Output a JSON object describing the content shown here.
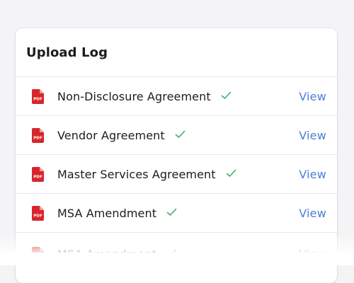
{
  "card": {
    "title": "Upload Log"
  },
  "uploads": [
    {
      "name": "Non-Disclosure Agreement",
      "status": "uploaded",
      "action_label": "View",
      "file_icon": "pdf-icon"
    },
    {
      "name": "Vendor Agreement",
      "status": "uploaded",
      "action_label": "View",
      "file_icon": "pdf-icon"
    },
    {
      "name": "Master Services Agreement",
      "status": "uploaded",
      "action_label": "View",
      "file_icon": "pdf-icon"
    },
    {
      "name": "MSA Amendment",
      "status": "uploaded",
      "action_label": "View",
      "file_icon": "pdf-icon"
    },
    {
      "name": "MSA Amendment",
      "status": "uploaded",
      "action_label": "View",
      "file_icon": "pdf-icon"
    }
  ],
  "icons": {
    "pdf_badge_text": "PDF",
    "status_icon": "check-icon"
  },
  "colors": {
    "background": "#f4f4f6",
    "pdf_red": "#d7262b",
    "check_green": "#3fae6d",
    "link_blue": "#4a7fd6",
    "text": "#1c1c1e"
  }
}
